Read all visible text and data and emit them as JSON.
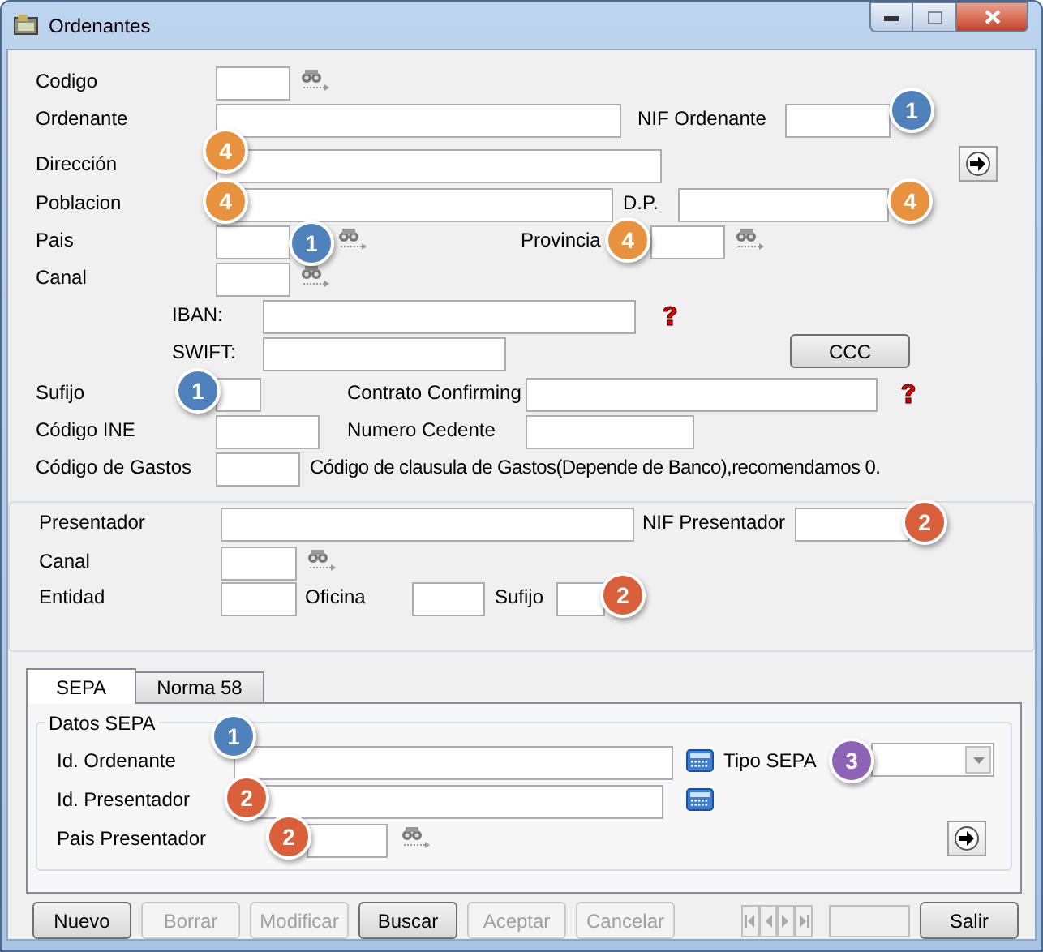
{
  "window": {
    "title": "Ordenantes"
  },
  "ordenante": {
    "codigo": {
      "label": "Codigo"
    },
    "ordenante": {
      "label": "Ordenante"
    },
    "nif_ordenante": {
      "label": "NIF Ordenante",
      "badge": {
        "text": "1",
        "color": "#4f81bd"
      }
    },
    "direccion": {
      "label": "Dirección",
      "badge": {
        "text": "4",
        "color": "#e8913f"
      }
    },
    "poblacion": {
      "label": "Poblacion",
      "badge": {
        "text": "4",
        "color": "#e8913f"
      }
    },
    "dp": {
      "label": "D.P.",
      "badge": {
        "text": "4",
        "color": "#e8913f"
      }
    },
    "pais": {
      "label": "Pais",
      "badge": {
        "text": "1",
        "color": "#4f81bd"
      }
    },
    "provincia": {
      "label": "Provincia",
      "badge": {
        "text": "4",
        "color": "#e8913f"
      }
    },
    "canal": {
      "label": "Canal"
    },
    "iban": {
      "label": "IBAN:"
    },
    "swift": {
      "label": "SWIFT:"
    },
    "ccc_button": "CCC",
    "sufijo": {
      "label": "Sufijo",
      "badge": {
        "text": "1",
        "color": "#4f81bd"
      }
    },
    "contrato_confirming": {
      "label": "Contrato Confirming"
    },
    "codigo_ine": {
      "label": "Código INE"
    },
    "numero_cedente": {
      "label": "Numero Cedente"
    },
    "codigo_gastos": {
      "label": "Código de Gastos",
      "note": "Código de clausula de Gastos(Depende de Banco),recomendamos 0."
    }
  },
  "presentador": {
    "presentador": {
      "label": "Presentador"
    },
    "nif_presentador": {
      "label": "NIF Presentador",
      "badge": {
        "text": "2",
        "color": "#d9603b"
      }
    },
    "canal": {
      "label": "Canal"
    },
    "entidad": {
      "label": "Entidad"
    },
    "oficina": {
      "label": "Oficina"
    },
    "sufijo": {
      "label": "Sufijo",
      "badge": {
        "text": "2",
        "color": "#d9603b"
      }
    }
  },
  "tabs": [
    {
      "label": "SEPA",
      "selected": true
    },
    {
      "label": "Norma 58",
      "selected": false
    }
  ],
  "sepa": {
    "group_title": "Datos SEPA",
    "id_ordenante": {
      "label": "Id. Ordenante",
      "badge": {
        "text": "1",
        "color": "#4f81bd"
      }
    },
    "tipo_sepa": {
      "label": "Tipo SEPA",
      "badge": {
        "text": "3",
        "color": "#8e63b5"
      }
    },
    "id_presentador": {
      "label": "Id. Presentador",
      "badge": {
        "text": "2",
        "color": "#d9603b"
      }
    },
    "pais_presentador": {
      "label": "Pais Presentador",
      "badge": {
        "text": "2",
        "color": "#d9603b"
      }
    }
  },
  "buttons": [
    {
      "label": "Nuevo",
      "disabled": false
    },
    {
      "label": "Borrar",
      "disabled": true
    },
    {
      "label": "Modificar",
      "disabled": true
    },
    {
      "label": "Buscar",
      "disabled": false
    },
    {
      "label": "Aceptar",
      "disabled": true
    },
    {
      "label": "Cancelar",
      "disabled": true
    },
    {
      "label": "Salir",
      "disabled": false
    }
  ]
}
